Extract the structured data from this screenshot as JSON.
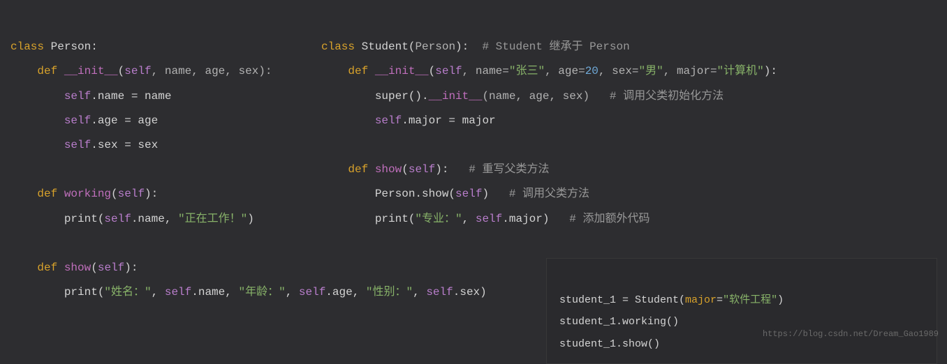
{
  "left": {
    "l1_class": "class",
    "l1_name": " Person",
    "l1_colon": ":",
    "l2_def": "def",
    "l2_fn": " __init__",
    "l2_open": "(",
    "l2_self": "self",
    "l2_rest": ", name, age, sex):",
    "l3_self": "self",
    "l3_rest": ".name = name",
    "l4_self": "self",
    "l4_rest": ".age = age",
    "l5_self": "self",
    "l5_rest": ".sex = sex",
    "l6_def": "def",
    "l6_fn": " working",
    "l6_open": "(",
    "l6_self": "self",
    "l6_rest": "):",
    "l7_print": "print(",
    "l7_self": "self",
    "l7_dot": ".name, ",
    "l7_str": "\"正在工作！\"",
    "l7_close": ")",
    "l8_def": "def",
    "l8_fn": " show",
    "l8_open": "(",
    "l8_self": "self",
    "l8_rest": "):",
    "l9_print": "print(",
    "l9_s1": "\"姓名：\"",
    "l9_c1": ", ",
    "l9_self1": "self",
    "l9_a1": ".name, ",
    "l9_s2": "\"年龄：\"",
    "l9_c2": ", ",
    "l9_self2": "self",
    "l9_a2": ".age, ",
    "l9_s3": "\"性别：\"",
    "l9_c3": ", ",
    "l9_self3": "self",
    "l9_a3": ".sex)"
  },
  "right": {
    "l1_class": "class",
    "l1_name": " Student",
    "l1_open": "(",
    "l1_base": "Person",
    "l1_close": "):",
    "l1_cmt": "  # Student 继承于 Person",
    "l2_def": "def",
    "l2_fn": " __init__",
    "l2_open": "(",
    "l2_self": "self",
    "l2_p1": ", name=",
    "l2_s1": "\"张三\"",
    "l2_p2": ", age=",
    "l2_n1": "20",
    "l2_p3": ", sex=",
    "l2_s2": "\"男\"",
    "l2_p4": ", major=",
    "l2_s3": "\"计算机\"",
    "l2_close": "):",
    "l3_super": "super",
    "l3_call": "().",
    "l3_init": "__init__",
    "l3_args": "(name, age, sex)",
    "l3_cmt": "   # 调用父类初始化方法",
    "l4_self": "self",
    "l4_rest": ".major = major",
    "l5_def": "def",
    "l5_fn": " show",
    "l5_open": "(",
    "l5_self": "self",
    "l5_rest": "):",
    "l5_cmt": "   # 重写父类方法",
    "l6_person": "Person.show(",
    "l6_self": "self",
    "l6_close": ")",
    "l6_cmt": "   # 调用父类方法",
    "l7_print": "print(",
    "l7_s1": "\"专业：\"",
    "l7_c1": ", ",
    "l7_self": "self",
    "l7_attr": ".major)",
    "l7_cmt": "   # 添加额外代码"
  },
  "small": {
    "l1_a": "student_1 = Student(",
    "l1_major": "major",
    "l1_eq": "=",
    "l1_str": "\"软件工程\"",
    "l1_close": ")",
    "l2": "student_1.working()",
    "l3": "student_1.show()"
  },
  "watermark": "https://blog.csdn.net/Dream_Gao1989"
}
